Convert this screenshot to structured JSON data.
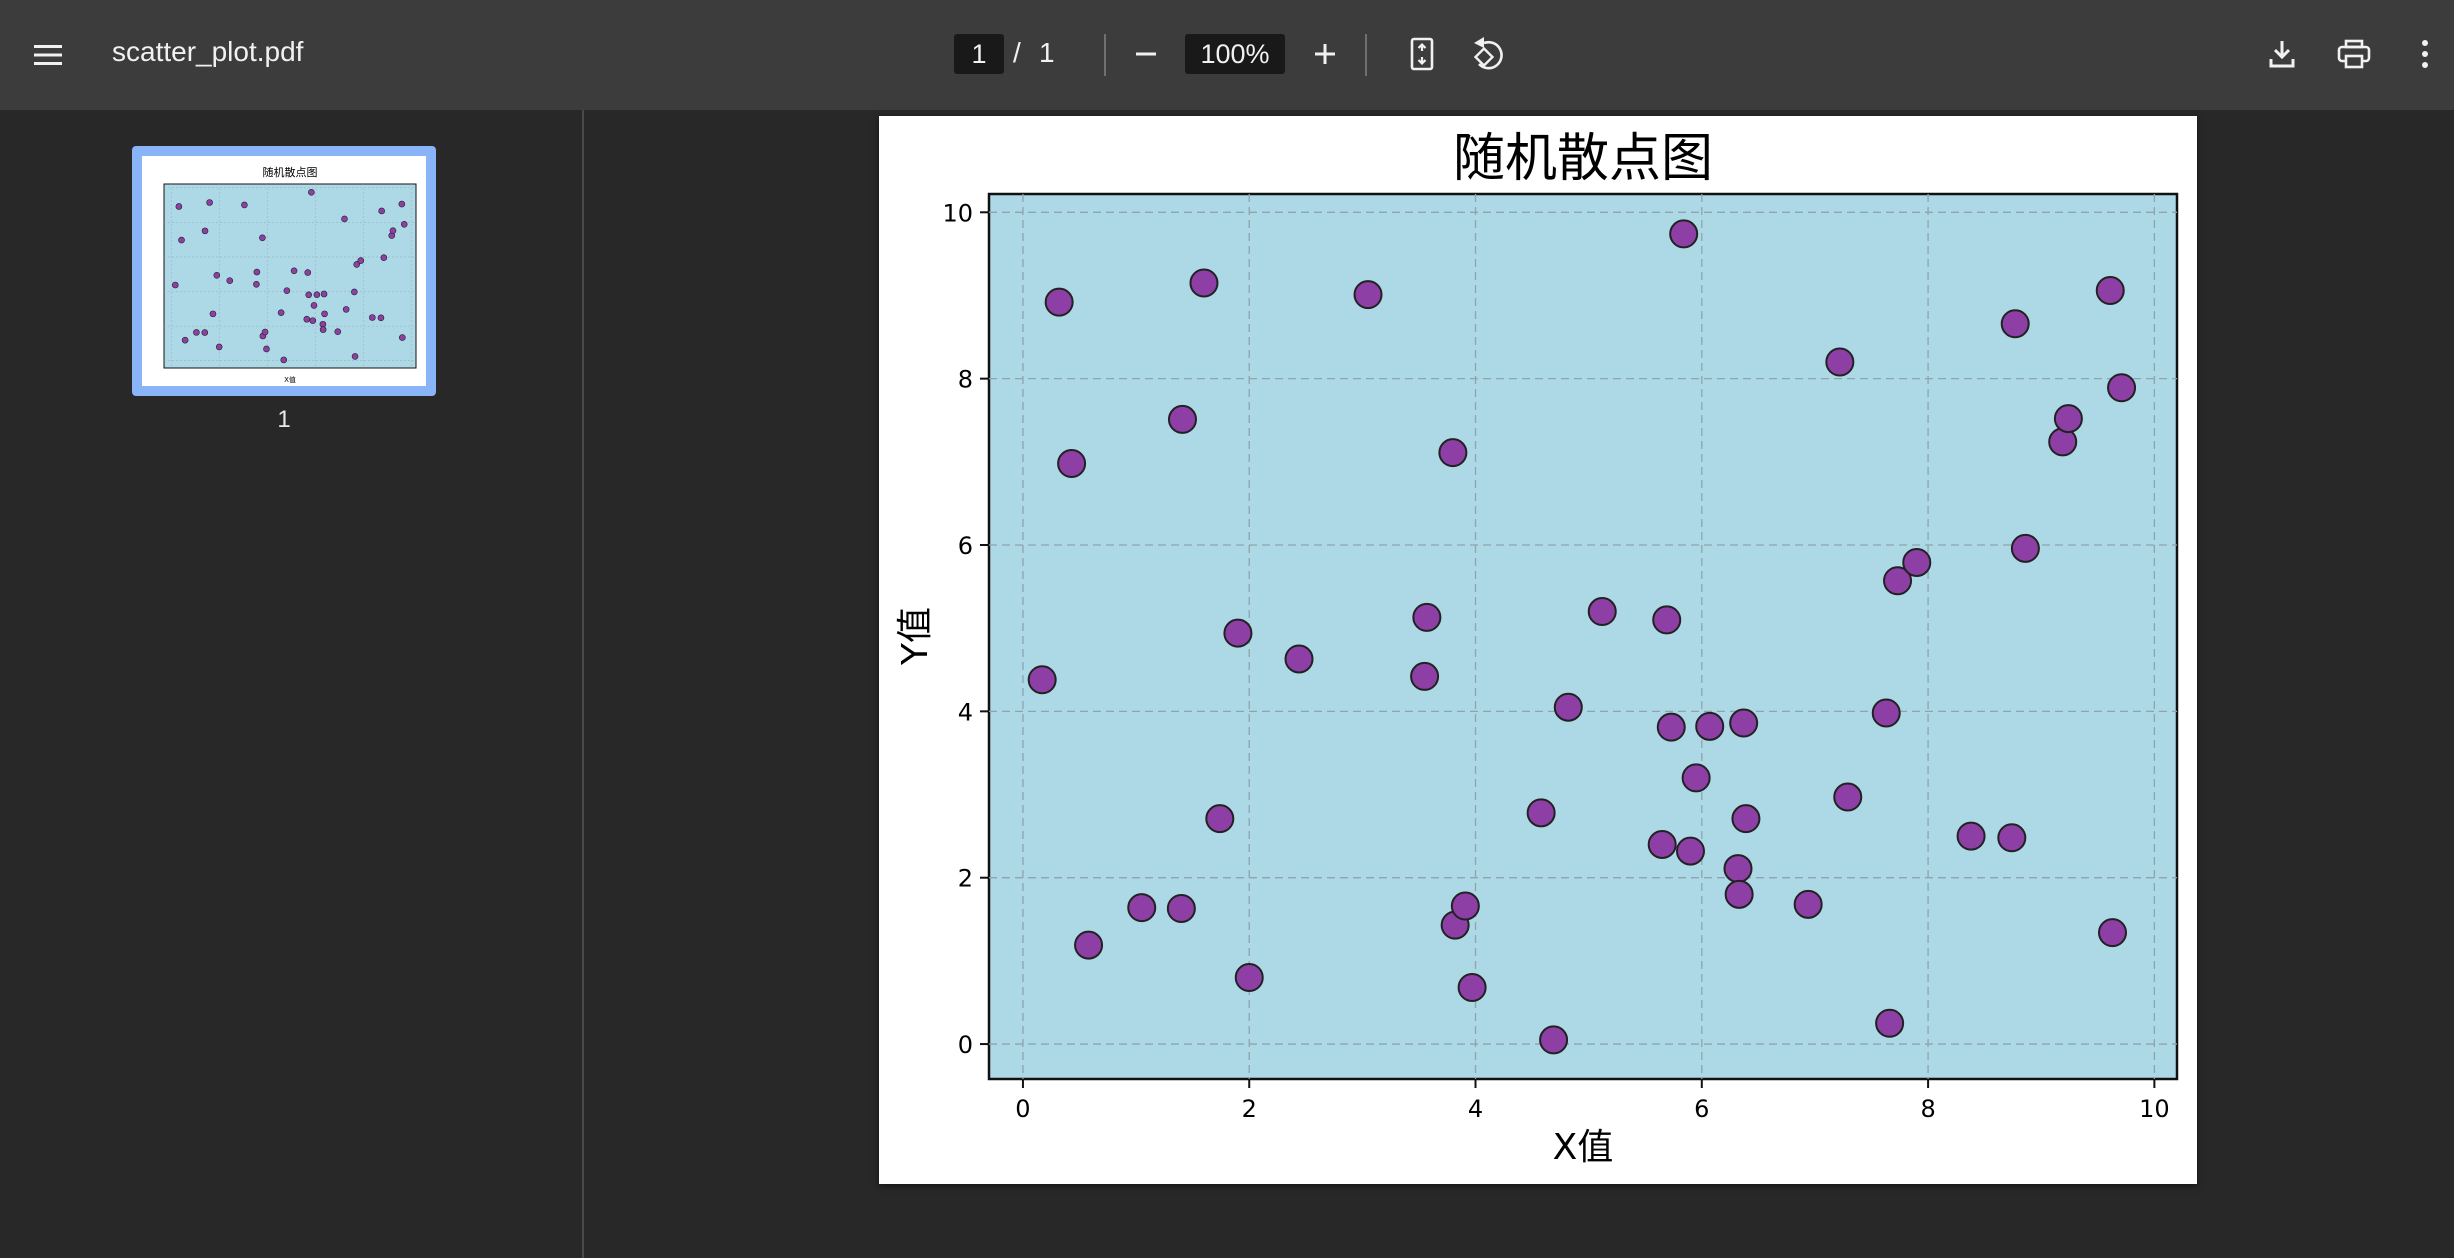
{
  "toolbar": {
    "filename": "scatter_plot.pdf",
    "page_current": "1",
    "page_sep": "/",
    "page_total": "1",
    "zoom": "100%"
  },
  "sidebar": {
    "thumbnail_label": "1"
  },
  "colors": {
    "toolbar_bg": "#3c3c3c",
    "viewer_bg": "#282828",
    "plot_bg": "#add8e6",
    "point_fill": "#8e3fa6",
    "thumb_border": "#8ab4f8"
  },
  "chart_data": {
    "type": "scatter",
    "title": "随机散点图",
    "xlabel": "X值",
    "ylabel": "Y值",
    "xlim": [
      -0.3,
      10.2
    ],
    "ylim": [
      -0.42,
      10.22
    ],
    "xticks": [
      0,
      2,
      4,
      6,
      8,
      10
    ],
    "yticks": [
      0,
      2,
      4,
      6,
      8,
      10
    ],
    "grid": true,
    "points": [
      {
        "x": 0.32,
        "y": 8.92
      },
      {
        "x": 0.43,
        "y": 6.98
      },
      {
        "x": 0.17,
        "y": 4.38
      },
      {
        "x": 0.58,
        "y": 1.19
      },
      {
        "x": 1.05,
        "y": 1.64
      },
      {
        "x": 1.4,
        "y": 1.63
      },
      {
        "x": 1.41,
        "y": 7.51
      },
      {
        "x": 1.6,
        "y": 9.15
      },
      {
        "x": 1.74,
        "y": 2.71
      },
      {
        "x": 1.9,
        "y": 4.94
      },
      {
        "x": 2.0,
        "y": 0.8
      },
      {
        "x": 2.44,
        "y": 4.63
      },
      {
        "x": 3.05,
        "y": 9.01
      },
      {
        "x": 3.55,
        "y": 4.42
      },
      {
        "x": 3.57,
        "y": 5.13
      },
      {
        "x": 3.8,
        "y": 7.11
      },
      {
        "x": 3.82,
        "y": 1.43
      },
      {
        "x": 3.91,
        "y": 1.66
      },
      {
        "x": 3.97,
        "y": 0.68
      },
      {
        "x": 4.58,
        "y": 2.78
      },
      {
        "x": 4.69,
        "y": 0.05
      },
      {
        "x": 4.82,
        "y": 4.05
      },
      {
        "x": 5.12,
        "y": 5.2
      },
      {
        "x": 5.65,
        "y": 2.4
      },
      {
        "x": 5.69,
        "y": 5.1
      },
      {
        "x": 5.73,
        "y": 3.81
      },
      {
        "x": 5.84,
        "y": 9.74
      },
      {
        "x": 5.9,
        "y": 2.32
      },
      {
        "x": 5.95,
        "y": 3.2
      },
      {
        "x": 6.07,
        "y": 3.82
      },
      {
        "x": 6.32,
        "y": 2.11
      },
      {
        "x": 6.33,
        "y": 1.8
      },
      {
        "x": 6.37,
        "y": 3.86
      },
      {
        "x": 6.39,
        "y": 2.71
      },
      {
        "x": 6.94,
        "y": 1.68
      },
      {
        "x": 7.22,
        "y": 8.2
      },
      {
        "x": 7.29,
        "y": 2.97
      },
      {
        "x": 7.63,
        "y": 3.98
      },
      {
        "x": 7.66,
        "y": 0.25
      },
      {
        "x": 7.73,
        "y": 5.57
      },
      {
        "x": 7.9,
        "y": 5.79
      },
      {
        "x": 8.38,
        "y": 2.5
      },
      {
        "x": 8.74,
        "y": 2.48
      },
      {
        "x": 8.77,
        "y": 8.66
      },
      {
        "x": 8.86,
        "y": 5.96
      },
      {
        "x": 9.19,
        "y": 7.24
      },
      {
        "x": 9.24,
        "y": 7.52
      },
      {
        "x": 9.61,
        "y": 9.06
      },
      {
        "x": 9.63,
        "y": 1.34
      },
      {
        "x": 9.71,
        "y": 7.89
      }
    ]
  }
}
